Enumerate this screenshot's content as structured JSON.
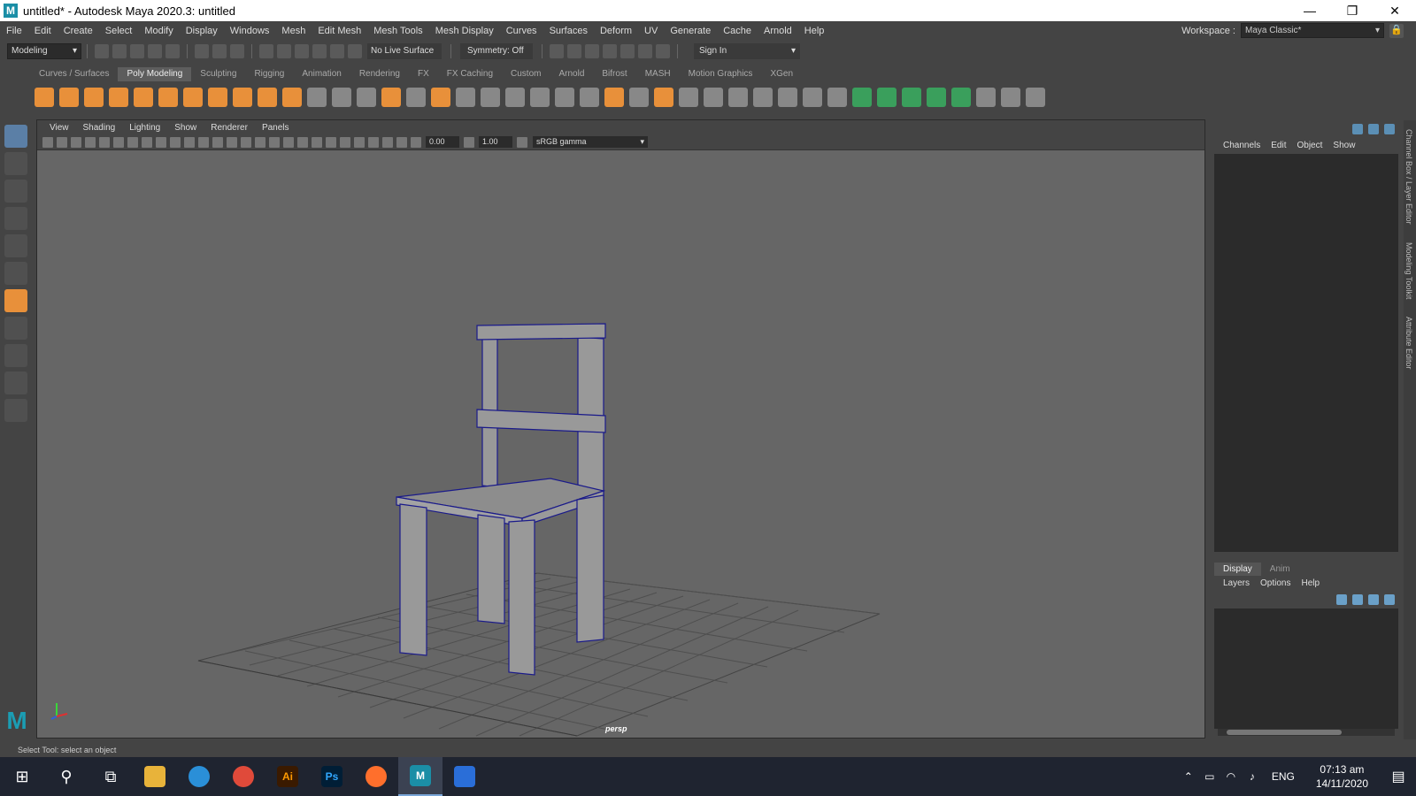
{
  "window": {
    "title": "untitled* - Autodesk Maya 2020.3: untitled",
    "app_icon_letter": "M",
    "controls": [
      "—",
      "❐",
      "✕"
    ]
  },
  "menubar": {
    "items": [
      "File",
      "Edit",
      "Create",
      "Select",
      "Modify",
      "Display",
      "Windows",
      "Mesh",
      "Edit Mesh",
      "Mesh Tools",
      "Mesh Display",
      "Curves",
      "Surfaces",
      "Deform",
      "UV",
      "Generate",
      "Cache",
      "Arnold",
      "Help"
    ],
    "workspace_label": "Workspace :",
    "workspace_value": "Maya Classic*"
  },
  "statusline": {
    "mode": "Modeling",
    "live_surface": "No Live Surface",
    "symmetry": "Symmetry: Off",
    "sign_in": "Sign In"
  },
  "shelf": {
    "tabs": [
      "Curves / Surfaces",
      "Poly Modeling",
      "Sculpting",
      "Rigging",
      "Animation",
      "Rendering",
      "FX",
      "FX Caching",
      "Custom",
      "Arnold",
      "Bifrost",
      "MASH",
      "Motion Graphics",
      "XGen"
    ],
    "active_tab": "Poly Modeling"
  },
  "viewport": {
    "menu": [
      "View",
      "Shading",
      "Lighting",
      "Show",
      "Renderer",
      "Panels"
    ],
    "exposure": "0.00",
    "gamma_value": "1.00",
    "color_space": "sRGB gamma",
    "camera": "persp"
  },
  "channel_box": {
    "menu": [
      "Channels",
      "Edit",
      "Object",
      "Show"
    ],
    "side_tabs": [
      "Channel Box / Layer Editor",
      "Modeling Toolkit",
      "Attribute Editor"
    ]
  },
  "layer_editor": {
    "tabs": [
      "Display",
      "Anim"
    ],
    "active_tab": "Display",
    "menu": [
      "Layers",
      "Options",
      "Help"
    ]
  },
  "helpline": "Select Tool: select an object",
  "taskbar": {
    "lang": "ENG",
    "time": "07:13 am",
    "date": "14/11/2020"
  },
  "colors": {
    "accent": "#1b8ea6",
    "shelf_orange": "#e8903a",
    "viewport_bg": "#666666",
    "wire_blue": "#1a1a8a"
  }
}
